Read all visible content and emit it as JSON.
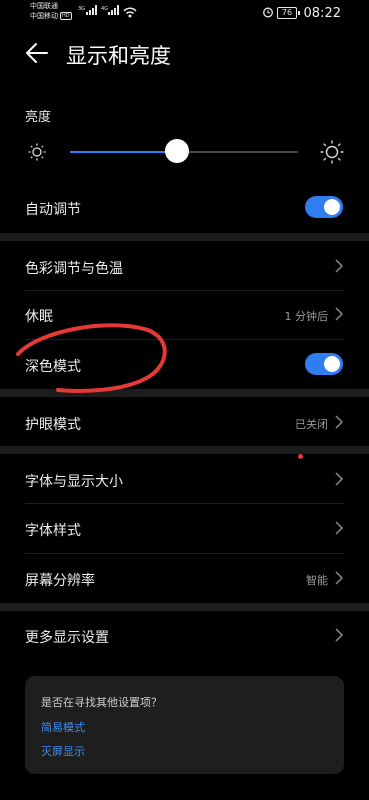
{
  "status_bar": {
    "carrier_1": "中国联通",
    "carrier_2": "中国移动",
    "hd_tag": "HD",
    "net_tag_1": "3G",
    "net_tag_2": "4G",
    "battery": "76",
    "time": "08:22"
  },
  "header": {
    "title": "显示和亮度"
  },
  "brightness": {
    "label": "亮度",
    "level_percent": 47
  },
  "rows": {
    "auto_adjust": {
      "label": "自动调节",
      "on": true
    },
    "color_temp": {
      "label": "色彩调节与色温"
    },
    "sleep": {
      "label": "休眠",
      "value": "1 分钟后"
    },
    "dark_mode": {
      "label": "深色模式",
      "on": true
    },
    "eye_comfort": {
      "label": "护眼模式",
      "value": "已关闭"
    },
    "font_size": {
      "label": "字体与显示大小"
    },
    "font_style": {
      "label": "字体样式"
    },
    "resolution": {
      "label": "屏幕分辨率",
      "value": "智能"
    },
    "more": {
      "label": "更多显示设置"
    }
  },
  "suggestion_card": {
    "question": "是否在寻找其他设置项？",
    "links": [
      "简易模式",
      "灭屏显示"
    ]
  },
  "colors": {
    "accent": "#2f7df0",
    "annotation": "#e53935",
    "background": "#000000"
  }
}
